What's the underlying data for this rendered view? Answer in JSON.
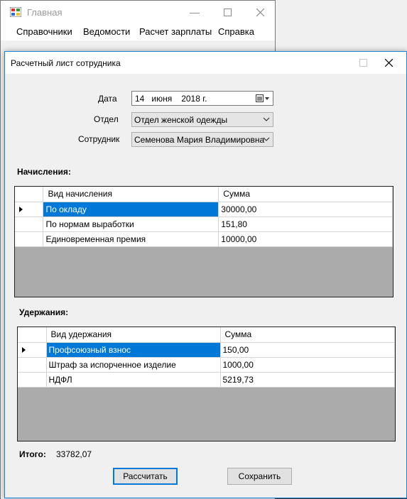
{
  "main_window": {
    "title": "Главная",
    "menu": [
      "Справочники",
      "Ведомости",
      "Расчет зарплаты",
      "Справка"
    ]
  },
  "dialog": {
    "title": "Расчетный лист сотрудника",
    "date_label": "Дата",
    "date": {
      "day": "14",
      "month": "июня",
      "year": "2018 г."
    },
    "department_label": "Отдел",
    "department_value": "Отдел женской одежды",
    "employee_label": "Сотрудник",
    "employee_value": "Семенова Мария Владимировна",
    "accruals": {
      "title": "Начисления:",
      "columns": [
        "Вид начисления",
        "Сумма"
      ],
      "rows": [
        [
          "По окладу",
          "30000,00"
        ],
        [
          "По нормам выработки",
          "151,80"
        ],
        [
          "Единовременная премия",
          "10000,00"
        ]
      ]
    },
    "deductions": {
      "title": "Удержания:",
      "columns": [
        "Вид удержания",
        "Сумма"
      ],
      "rows": [
        [
          "Профсоюзный взнос",
          "150,00"
        ],
        [
          "Штраф за испорченное изделие",
          "1000,00"
        ],
        [
          "НДФЛ",
          "5219,73"
        ]
      ]
    },
    "total_label": "Итого:",
    "total_value": "33782,07",
    "calc_button": "Рассчитать",
    "save_button": "Сохранить"
  }
}
